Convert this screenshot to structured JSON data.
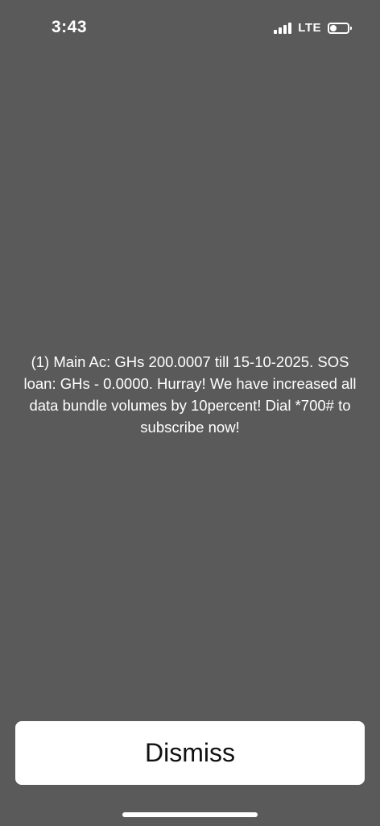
{
  "status_bar": {
    "time": "3:43",
    "signal_icon": "cellular-signal-icon",
    "network": "LTE",
    "battery_icon": "battery-icon"
  },
  "ussd": {
    "message": "(1) Main Ac: GHs 200.0007 till 15-10-2025. SOS loan: GHs - 0.0000. Hurray! We have increased all data bundle volumes by 10percent! Dial *700# to subscribe now!",
    "dismiss_label": "Dismiss"
  },
  "colors": {
    "background": "#5a5a5a",
    "text": "#ffffff",
    "button": "#ffffff"
  }
}
